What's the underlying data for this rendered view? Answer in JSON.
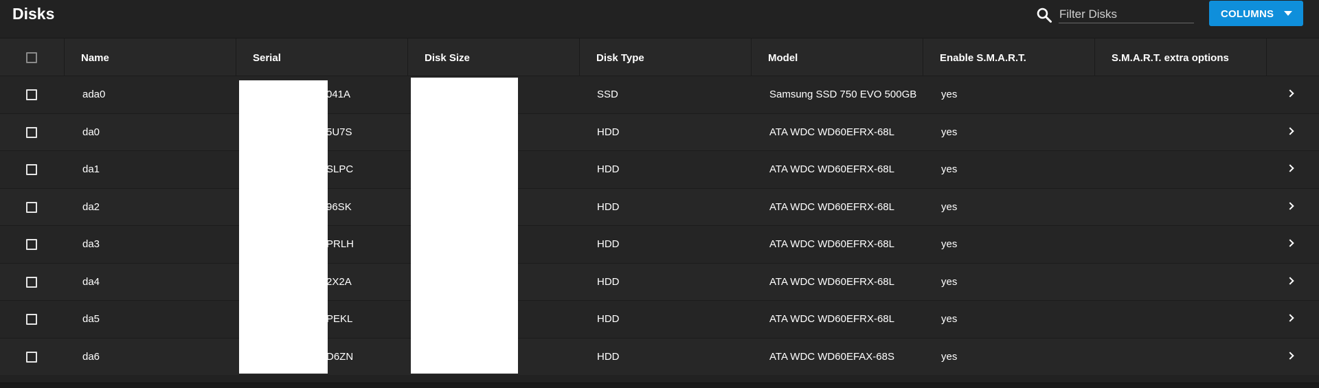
{
  "header": {
    "title": "Disks",
    "search": {
      "placeholder": "Filter Disks",
      "value": "",
      "icon": "search-icon"
    },
    "columns_button": {
      "label": "COLUMNS",
      "color": "#0f8fdb"
    }
  },
  "table": {
    "columns": [
      "Name",
      "Serial",
      "Disk Size",
      "Disk Type",
      "Model",
      "Enable S.M.A.R.T.",
      "S.M.A.R.T. extra options"
    ],
    "rows": [
      {
        "name": "ada0",
        "serial": "041A",
        "size": "",
        "type": "SSD",
        "model": "Samsung SSD 750 EVO 500GB",
        "smart": "yes",
        "smart_extra": ""
      },
      {
        "name": "da0",
        "serial": "5U7S",
        "size": "",
        "type": "HDD",
        "model": "ATA WDC WD60EFRX-68L",
        "smart": "yes",
        "smart_extra": ""
      },
      {
        "name": "da1",
        "serial": "SLPC",
        "size": "",
        "type": "HDD",
        "model": "ATA WDC WD60EFRX-68L",
        "smart": "yes",
        "smart_extra": ""
      },
      {
        "name": "da2",
        "serial": "96SK",
        "size": "",
        "type": "HDD",
        "model": "ATA WDC WD60EFRX-68L",
        "smart": "yes",
        "smart_extra": ""
      },
      {
        "name": "da3",
        "serial": "PRLH",
        "size": "",
        "type": "HDD",
        "model": "ATA WDC WD60EFRX-68L",
        "smart": "yes",
        "smart_extra": ""
      },
      {
        "name": "da4",
        "serial": "2X2A",
        "size": "",
        "type": "HDD",
        "model": "ATA WDC WD60EFRX-68L",
        "smart": "yes",
        "smart_extra": ""
      },
      {
        "name": "da5",
        "serial": "PEKL",
        "size": "",
        "type": "HDD",
        "model": "ATA WDC WD60EFRX-68L",
        "smart": "yes",
        "smart_extra": ""
      },
      {
        "name": "da6",
        "serial": "D6ZN",
        "size": "",
        "type": "HDD",
        "model": "ATA WDC WD60EFAX-68S",
        "smart": "yes",
        "smart_extra": ""
      }
    ]
  }
}
